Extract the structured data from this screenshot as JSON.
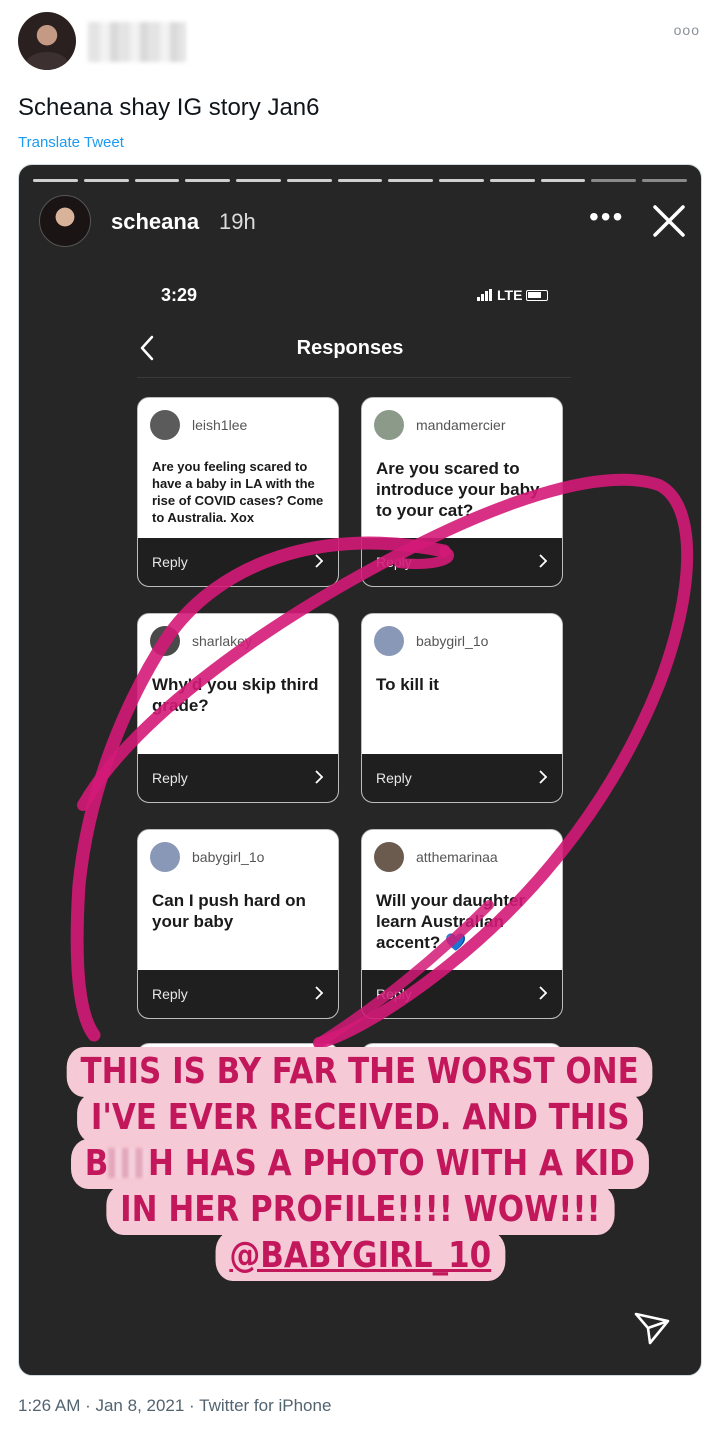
{
  "tweet": {
    "text": "Scheana shay IG story Jan6",
    "translate_label": "Translate Tweet",
    "more_label": "ooo",
    "footer": "1:26 AM · Jan 8, 2021 · Twitter for iPhone"
  },
  "story": {
    "username": "scheana",
    "time": "19h",
    "more_label": "•••",
    "progress_segments_total": 13,
    "progress_segments_viewed": 11,
    "phone": {
      "time": "3:29",
      "network": "LTE",
      "title": "Responses"
    },
    "cards": [
      {
        "username": "leish1lee",
        "question": "Are you feeling scared to have a baby in LA with the rise of COVID cases? Come to Australia. Xox",
        "reply": "Reply"
      },
      {
        "username": "mandamercier",
        "question": "Are you scared to introduce your baby to your cat?",
        "reply": "Reply"
      },
      {
        "username": "sharlakey",
        "question": "Why'd you skip third grade?",
        "reply": "Reply"
      },
      {
        "username": "babygirl_1o",
        "question": "To kill it",
        "reply": "Reply"
      },
      {
        "username": "babygirl_1o",
        "question": "Can I push hard on your baby",
        "reply": "Reply"
      },
      {
        "username": "atthemarinaa",
        "question": "Will your daughter learn Australian accent? 💙",
        "reply": "Reply"
      }
    ],
    "caption": {
      "line1": "THIS IS BY FAR THE WORST ONE",
      "line2": "I'VE EVER RECEIVED. AND THIS",
      "line3_a": "B",
      "line3_b": "H HAS A PHOTO WITH A KID",
      "line4": "IN HER PROFILE!!!! WOW!!!",
      "mention": "@BABYGIRL_10"
    },
    "colors": {
      "background": "#262626",
      "scribble": "#d41a78",
      "caption_bg": "#f6c9d6",
      "caption_text": "#c2185b"
    }
  }
}
